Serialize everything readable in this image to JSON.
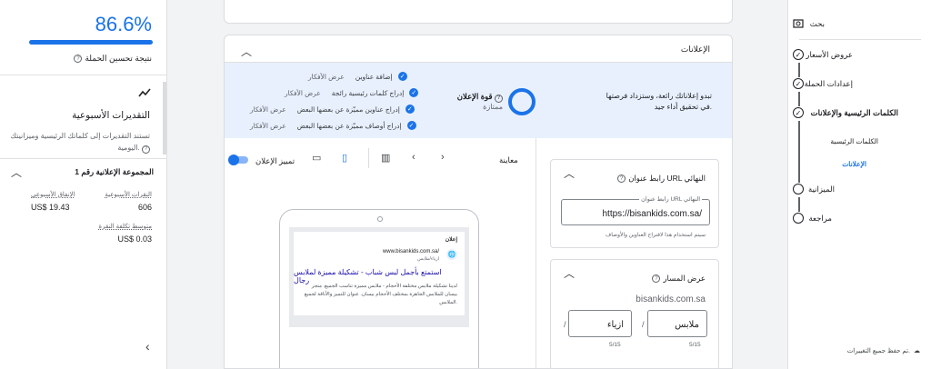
{
  "left_panel": {
    "score_value": "86.6%",
    "score_fraction": 0.866,
    "score_label": "نتيجة تحسين الحملة",
    "weekly_title": "التقديرات الأسبوعية",
    "weekly_desc": "تستند التقديرات إلى كلماتك الرئيسية وميزانيتك اليومية.",
    "group_title": "المجموعة الإعلانية رقم 1",
    "metrics": [
      {
        "label": "الإنفاق الأسبوعي",
        "value": "US$ 19.43"
      },
      {
        "label": "النقرات الأسبوعية",
        "value": "606"
      },
      {
        "label": "متوسط تكلفة النقرة",
        "value": "US$ 0.03"
      }
    ]
  },
  "ads_section": {
    "title": "الإعلانات",
    "strength_text": "تبدو إعلاناتك رائعة، وستزداد فرصتها في تحقيق أداء جيد.",
    "strength_label": "قوة الإعلان",
    "strength_value": "ممتازة",
    "suggestions": [
      {
        "text": "إضافة عناوين",
        "action": "عرض الأفكار"
      },
      {
        "text": "إدراج كلمات رئيسية رائجة",
        "action": "عرض الأفكار"
      },
      {
        "text": "إدراج عناوين مميّزة عن بعضها البعض",
        "action": "عرض الأفكار"
      },
      {
        "text": "إدراج أوصاف مميّزة عن بعضها البعض",
        "action": "عرض الأفكار"
      }
    ]
  },
  "preview": {
    "label": "معاينة",
    "toggle_label": "تمييز الإعلان",
    "ad_label": "إعلان",
    "display_url": "www.bisankids.com.sa/",
    "display_sub": "ازياء/ملابس",
    "headline": "استمتع بأجمل لبس شباب - تشكيلة مميزة لملابس رجال",
    "description": "لدينا تشكيلة ملابس مختلفة الأحجام - ملابس مميزة تناسب الجميع. متجر بيسان للملابس الجاهزة بمختلف الأحجام بيسان. عنوان للتميز والأناقة لجميع الملابس."
  },
  "final_url": {
    "title": "رابط عنوان URL النهائي",
    "field_label": "رابط عنوان URL النهائي",
    "value": "https://bisankids.com.sa/",
    "hint": "سيتم استخدام هذا لاقتراح العناوين والأوصاف"
  },
  "display_path": {
    "title": "عرض المسار",
    "domain": "bisankids.com.sa",
    "path1": "ملابس",
    "path2": "ازياء",
    "count1": "5/15",
    "count2": "5/15"
  },
  "nav": {
    "search": "بحث",
    "items": [
      {
        "label": "عروض الأسعار",
        "state": "done"
      },
      {
        "label": "إعدادات الحملة",
        "state": "done"
      },
      {
        "label": "الكلمات الرئيسية والإعلانات",
        "state": "done"
      },
      {
        "label": "الميزانية",
        "state": "empty"
      },
      {
        "label": "مراجعة",
        "state": "empty"
      }
    ],
    "sub_items": [
      {
        "label": "الكلمات الرئيسية",
        "active": false
      },
      {
        "label": "الإعلانات",
        "active": true
      }
    ],
    "saved": "تم حفظ جميع التغييرات."
  },
  "colors": {
    "accent": "#1a73e8",
    "highlight_bg": "#e8f0fe"
  }
}
